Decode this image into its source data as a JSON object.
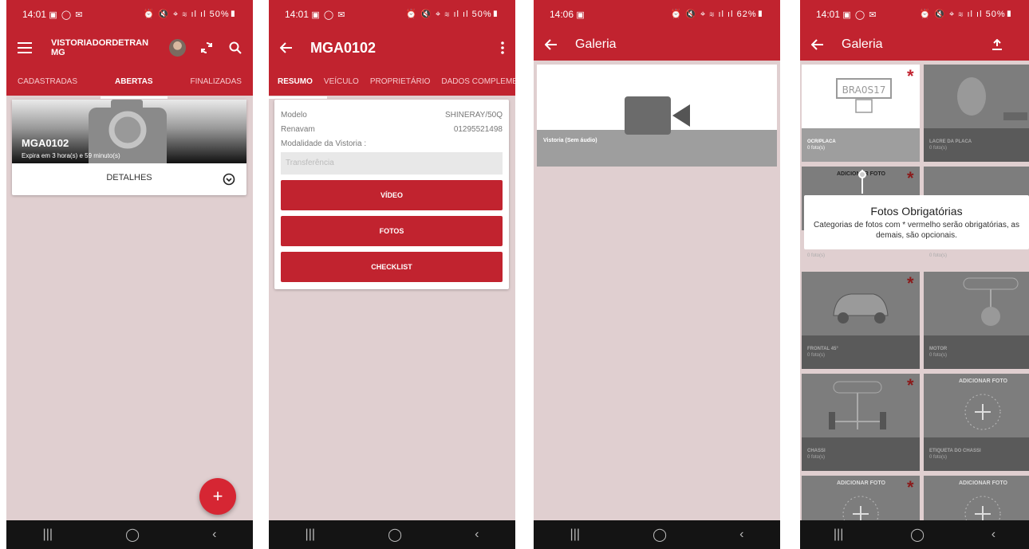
{
  "screen1": {
    "status": {
      "time": "14:01",
      "left_icons": "▣ ◯ ✉",
      "right_icons": "⏰ 🔇 ⌖ ≋ ıl ıl 50%▮"
    },
    "title": "VISTORIADORDETRAN MG",
    "tabs": [
      "CADASTRADAS",
      "ABERTAS",
      "FINALIZADAS"
    ],
    "active_tab": "ABERTAS",
    "card": {
      "plate": "MGA0102",
      "expires": "Expira em 3 hora(s) e 59 minuto(s)",
      "details_label": "DETALHES"
    },
    "fab": "+"
  },
  "screen2": {
    "status": {
      "time": "14:01",
      "left_icons": "▣ ◯ ✉",
      "right_icons": "⏰ 🔇 ⌖ ≋ ıl ıl 50%▮"
    },
    "title": "MGA0102",
    "tabs": [
      "RESUMO",
      "VEÍCULO",
      "PROPRIETÁRIO",
      "DADOS COMPLEMENTA"
    ],
    "active_tab": "RESUMO",
    "rows": [
      {
        "label": "Modelo",
        "value": "SHINERAY/50Q"
      },
      {
        "label": "Renavam",
        "value": "01295521498"
      }
    ],
    "modalidade_label": "Modalidade da Vistoria :",
    "modalidade_value": "Transferência",
    "buttons": [
      "VÍDEO",
      "FOTOS",
      "CHECKLIST"
    ]
  },
  "screen3": {
    "status": {
      "time": "14:06",
      "left_icons": "▣",
      "right_icons": "⏰ 🔇 ⌖ ≋ ıl ıl 62%▮"
    },
    "title": "Galeria",
    "video_label": "Vistoria (Sem áudio)"
  },
  "screen4": {
    "status": {
      "time": "14:01",
      "left_icons": "▣ ◯ ✉",
      "right_icons": "⏰ 🔇 ⌖ ≋ ıl ıl 50%▮"
    },
    "title": "Galeria",
    "plate_text": "BRA0S17",
    "tiles": [
      {
        "name": "OCR/PLACA",
        "count": "0 foto(s)",
        "required": true
      },
      {
        "name": "LACRE DA PLACA",
        "count": "0 foto(s)",
        "required": false
      },
      {
        "name": "",
        "count": "0 foto(s)",
        "required": true,
        "overlay": "ADICIONAR FOTO"
      },
      {
        "name": "",
        "count": "0 foto(s)",
        "required": false
      },
      {
        "name": "FRONTAL 45°",
        "count": "0 foto(s)",
        "required": true
      },
      {
        "name": "MOTOR",
        "count": "0 foto(s)",
        "required": false
      },
      {
        "name": "CHASSI",
        "count": "0 foto(s)",
        "required": true
      },
      {
        "name": "ETIQUETA DO CHASSI",
        "count": "0 foto(s)",
        "required": false,
        "overlay": "ADICIONAR FOTO"
      },
      {
        "name": "",
        "count": "",
        "required": true,
        "overlay": "ADICIONAR FOTO"
      },
      {
        "name": "",
        "count": "",
        "required": false,
        "overlay": "ADICIONAR FOTO"
      }
    ],
    "tooltip": {
      "title": "Fotos Obrigatórias",
      "text": "Categorias de fotos com * vermelho serão obrigatórias, as demais, são opcionais."
    }
  },
  "navbar": {
    "recent": "|||",
    "home": "◯",
    "back": "‹"
  },
  "colors": {
    "brand_red": "#c1232f",
    "background": "#e0cfd0",
    "required_star": "#8b1a1a"
  }
}
